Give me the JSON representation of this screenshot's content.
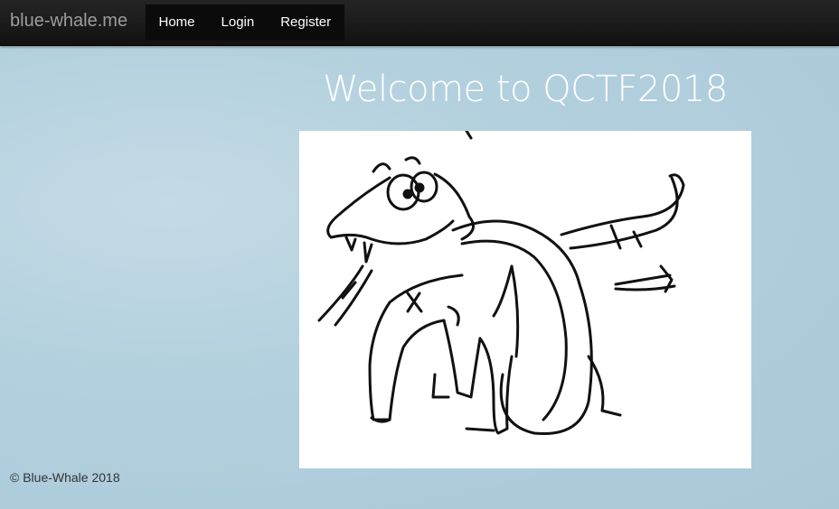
{
  "navbar": {
    "brand": "blue-whale.me",
    "items": [
      {
        "label": "Home"
      },
      {
        "label": "Login"
      },
      {
        "label": "Register"
      }
    ]
  },
  "main": {
    "title": "Welcome to QCTF2018"
  },
  "footer": {
    "text": "© Blue-Whale 2018"
  }
}
